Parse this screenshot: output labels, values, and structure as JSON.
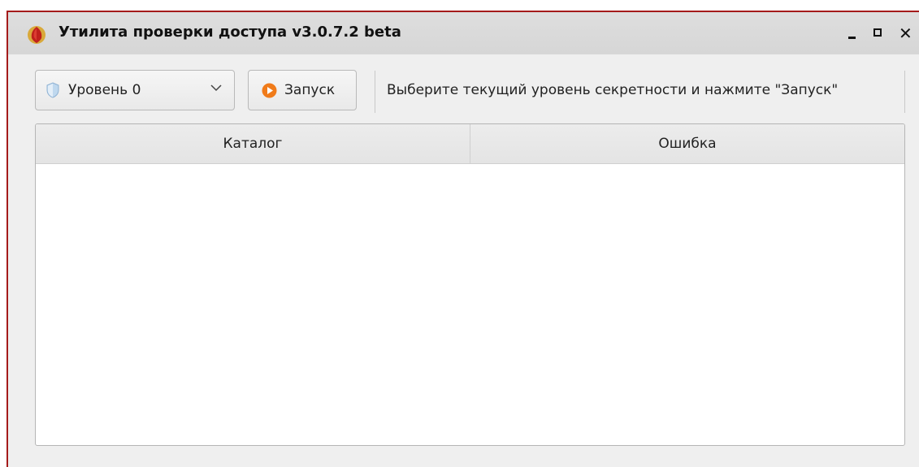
{
  "window": {
    "title": "Утилита проверки доступа v3.0.7.2 beta",
    "icon": "app-shield-icon",
    "controls": {
      "minimize": "minimize-icon",
      "maximize": "maximize-icon",
      "close": "close-icon"
    },
    "border_color": "#a41b1b"
  },
  "toolbar": {
    "level_select": {
      "value": "Уровень 0",
      "icon": "shield-icon"
    },
    "run_button": {
      "label": "Запуск",
      "icon": "play-icon",
      "icon_color": "#f07b1a"
    },
    "status_text": "Выберите текущий уровень секретности и нажмите \"Запуск\""
  },
  "table": {
    "columns": [
      "Каталог",
      "Ошибка"
    ],
    "rows": []
  }
}
